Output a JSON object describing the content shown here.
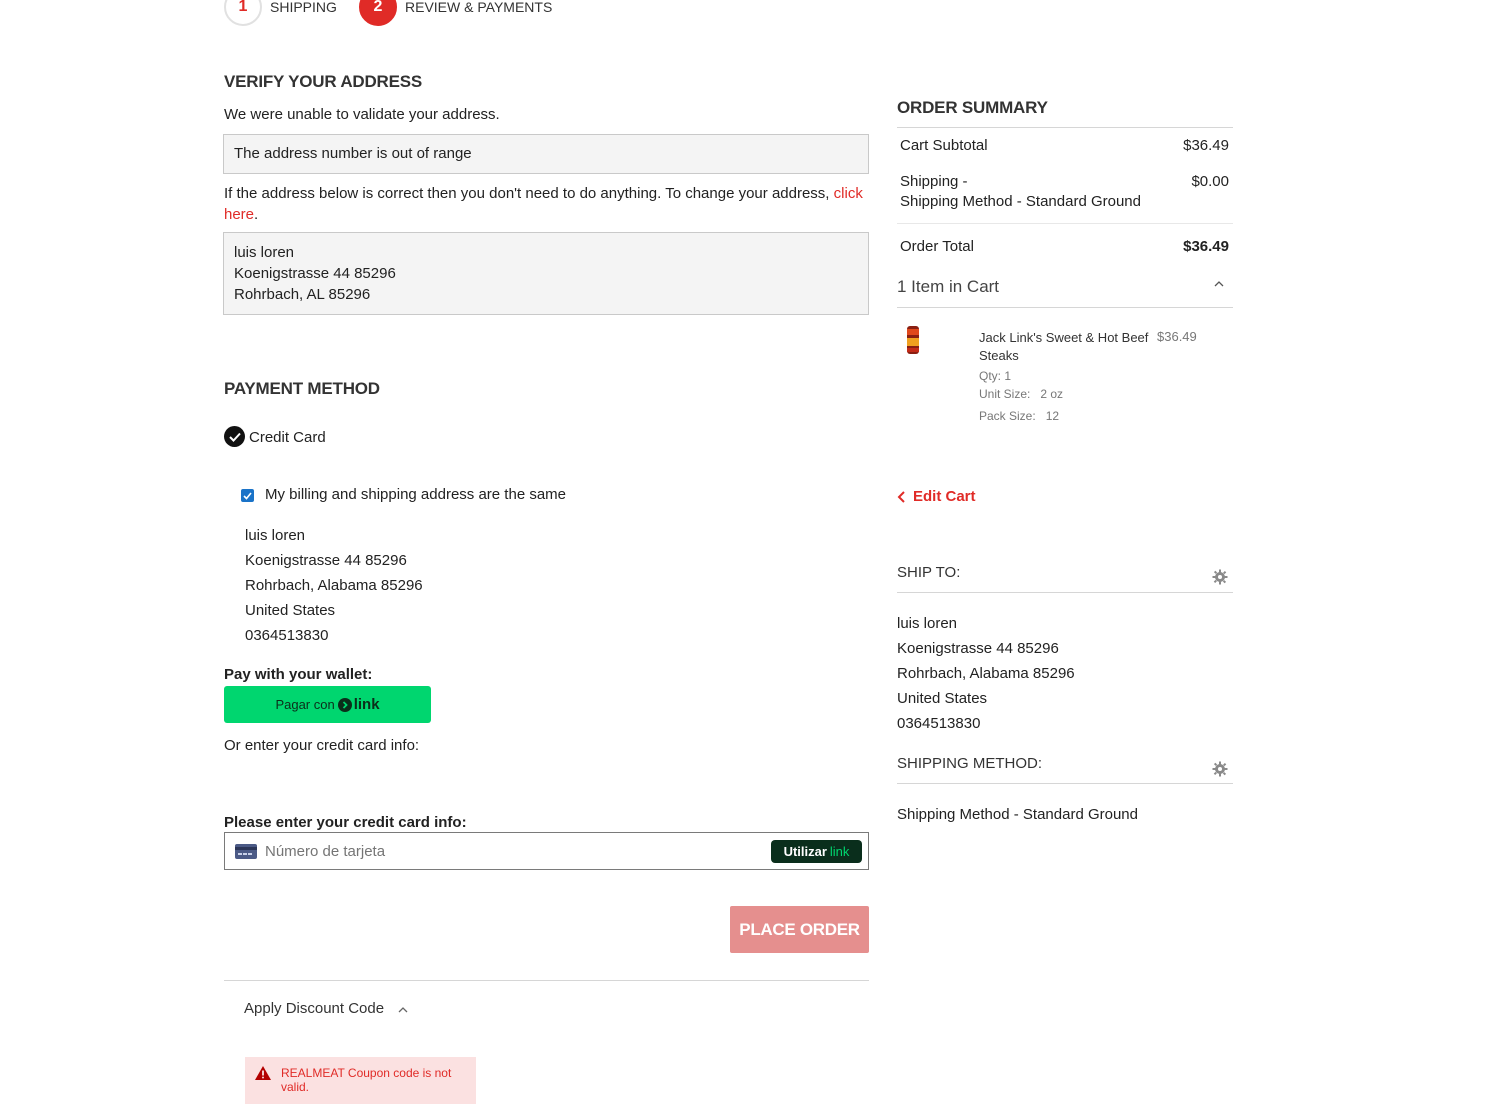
{
  "steps": [
    {
      "number": "1",
      "label": "Shipping"
    },
    {
      "number": "2",
      "label": "Review & Payments"
    }
  ],
  "verify": {
    "title": "Verify Your Address",
    "intro": "We were unable to validate your address.",
    "error": "The address number is out of range",
    "note": "If the address below is correct then you don't need to do anything. To change your address,",
    "note_link_1": "click",
    "note_link_2": "here",
    "note_end": ".",
    "address": [
      "luis loren",
      "Koenigstrasse 44 85296",
      "Rohrbach, AL 85296"
    ]
  },
  "payment": {
    "title": "Payment Method",
    "method_label": "Credit Card",
    "same_address_label": "My billing and shipping address are the same",
    "billing_address": [
      "luis loren",
      "Koenigstrasse 44 85296",
      "Rohrbach, Alabama 85296",
      "United States"
    ],
    "billing_phone": "0364513830",
    "wallet_label": "Pay with your wallet:",
    "wallet_button_prefix": "Pagar con",
    "wallet_button_brand": "link",
    "or_enter": "Or enter your credit card info:",
    "card_label": "Please enter your credit card info:",
    "card_placeholder": "Número de tarjeta",
    "use_link_prefix": "Utilizar",
    "use_link_brand": "link",
    "place_order": "PLACE ORDER"
  },
  "discount": {
    "label": "Apply Discount Code",
    "error": "REALMEAT Coupon code is not valid."
  },
  "summary": {
    "title": "Order Summary",
    "subtotal_label": "Cart Subtotal",
    "subtotal_value": "$36.49",
    "shipping_label": "Shipping -",
    "shipping_method": "Shipping Method - Standard Ground",
    "shipping_value": "$0.00",
    "total_label": "Order Total",
    "total_value": "$36.49",
    "items_in_cart": "1 Item in Cart",
    "item": {
      "name": "Jack Link's Sweet & Hot Beef Steaks",
      "price": "$36.49",
      "qty": "Qty: 1",
      "unit_size_label": "Unit Size:",
      "unit_size_value": "2 oz",
      "pack_size_label": "Pack Size:",
      "pack_size_value": "12"
    },
    "edit_cart": "Edit Cart"
  },
  "ship_to": {
    "title": "Ship To:",
    "address": [
      "luis loren",
      "Koenigstrasse 44 85296",
      "Rohrbach, Alabama 85296",
      "United States"
    ],
    "phone": "0364513830"
  },
  "shipping_method": {
    "title": "Shipping Method:",
    "value": "Shipping Method - Standard Ground"
  },
  "colors": {
    "accent_red": "#e02b27",
    "link_green": "#00d66f",
    "place_order_disabled": "#e58f8e"
  }
}
